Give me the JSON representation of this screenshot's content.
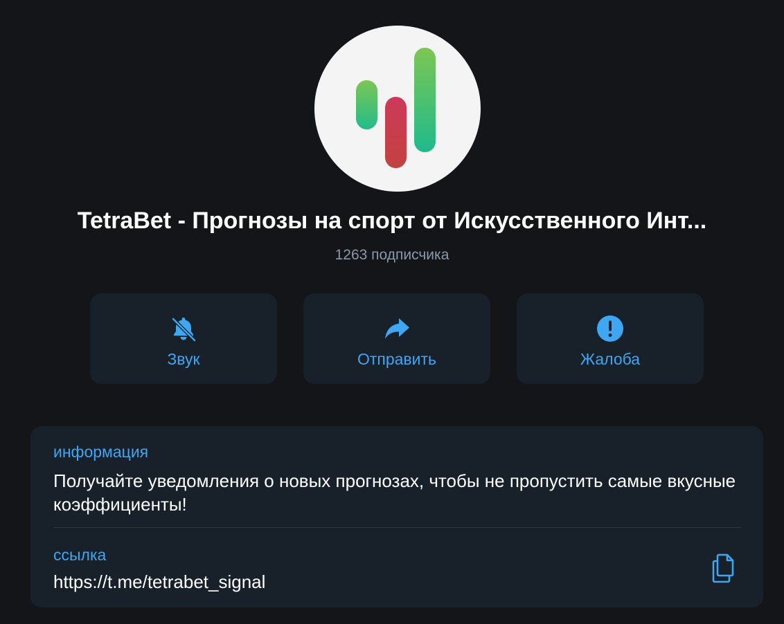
{
  "channel": {
    "title": "TetraBet - Прогнозы на спорт от Искусственного Инт...",
    "subscribers": "1263 подписчика",
    "avatar_icon": "bars-chart-logo"
  },
  "actions": [
    {
      "label": "Звук",
      "icon": "bell-slash-icon"
    },
    {
      "label": "Отправить",
      "icon": "share-arrow-icon"
    },
    {
      "label": "Жалоба",
      "icon": "exclamation-circle-icon"
    }
  ],
  "info": {
    "description_label": "информация",
    "description_text": "Получайте уведомления о новых прогнозах, чтобы не пропустить самые вкусные коэффициенты!",
    "link_label": "ссылка",
    "link_value": "https://t.me/tetrabet_signal",
    "copy_icon": "copy-icon"
  },
  "colors": {
    "background": "#141518",
    "card": "#18202a",
    "accent": "#3ea6f2",
    "subtitle": "#8a9aaa",
    "logo_green": "#2bbf86",
    "logo_red": "#c83f55"
  }
}
